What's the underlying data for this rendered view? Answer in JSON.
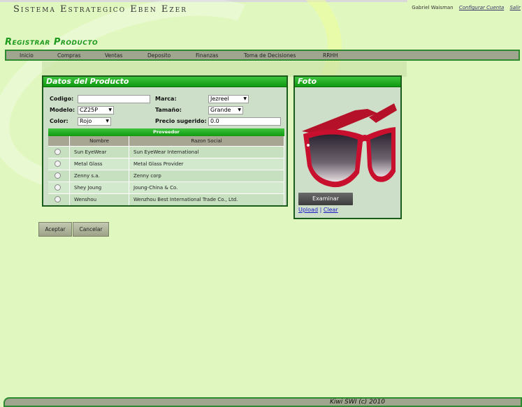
{
  "app": {
    "title": "Sistema Estrategico Eben Ezer"
  },
  "user": {
    "name": "Gabriel Waisman",
    "config_link": "Configurar Cuenta",
    "logout_link": "Salir"
  },
  "page": {
    "title": "Registrar Producto"
  },
  "nav": [
    "Inicio",
    "Compras",
    "Ventas",
    "Deposito",
    "Finanzas",
    "Toma de Decisiones",
    "RRHH"
  ],
  "product_panel": {
    "title": "Datos del Producto",
    "codigo": {
      "label": "Codigo:",
      "value": ""
    },
    "marca": {
      "label": "Marca:",
      "value": "Jezreel"
    },
    "modelo": {
      "label": "Modelo:",
      "value": "CZ25P"
    },
    "tamano": {
      "label": "Tamaño:",
      "value": "Grande"
    },
    "color": {
      "label": "Color:",
      "value": "Rojo"
    },
    "precio": {
      "label": "Precio sugerido:",
      "value": "0.0"
    }
  },
  "proveedor_grid": {
    "title": "Proveedor",
    "headers": [
      "Nombre",
      "Razon Social"
    ],
    "rows": [
      {
        "nombre": "Sun EyeWear",
        "razon": "Sun EyeWear International"
      },
      {
        "nombre": "Metal Glass",
        "razon": "Metal Glass Provider"
      },
      {
        "nombre": "Zenny s.a.",
        "razon": "Zenny corp"
      },
      {
        "nombre": "Shey Joung",
        "razon": "Joung-China & Co."
      },
      {
        "nombre": "Wenshou",
        "razon": "Wenzhou Best International Trade Co., Ltd."
      }
    ]
  },
  "foto_panel": {
    "title": "Foto",
    "browse": "Examinar",
    "upload": "Upload",
    "sep": "|",
    "clear": "Clear"
  },
  "actions": {
    "accept": "Aceptar",
    "cancel": "Cancelar"
  },
  "footer": {
    "text": "Kiwi SWI (c) 2010"
  },
  "colors": {
    "background": "#e1f7c0",
    "accent_green": "#1d9a1d",
    "nav_gray": "#9fa58f",
    "glasses_red": "#c8102e"
  }
}
